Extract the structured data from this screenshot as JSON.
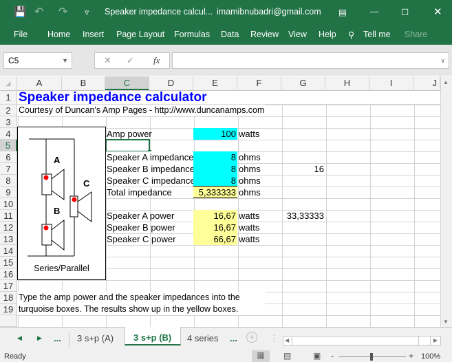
{
  "title_bar": {
    "doc_title": "Speaker impedance calcul...",
    "account": "imamibnubadri@gmail.com"
  },
  "ribbon": {
    "tabs": [
      "File",
      "Home",
      "Insert",
      "Page Layout",
      "Formulas",
      "Data",
      "Review",
      "View",
      "Help"
    ],
    "tell_me": "Tell me",
    "share": "Share"
  },
  "formula_bar": {
    "name_box": "C5",
    "fx": "fx",
    "value": ""
  },
  "columns": [
    "A",
    "B",
    "C",
    "D",
    "E",
    "F",
    "G",
    "H",
    "I",
    "J"
  ],
  "rows": [
    "1",
    "2",
    "3",
    "4",
    "5",
    "6",
    "7",
    "8",
    "9",
    "10",
    "11",
    "12",
    "13",
    "14",
    "15",
    "16",
    "17",
    "18",
    "19"
  ],
  "sheet": {
    "title": "Speaker impedance calculator",
    "courtesy": "Courtesy of Duncan's Amp Pages - http://www.duncanamps.com",
    "amp_label": "Amp power",
    "amp_value": "100",
    "amp_unit": "watts",
    "a_imp_label": "Speaker A impedance",
    "a_imp": "8",
    "a_imp_unit": "ohms",
    "b_imp_label": "Speaker B impedance",
    "b_imp": "8",
    "b_imp_unit": "ohms",
    "g7": "16",
    "c_imp_label": "Speaker C impedance",
    "c_imp": "8",
    "c_imp_unit": "ohms",
    "total_label": "Total impedance",
    "total": "5,333333",
    "total_unit": "ohms",
    "a_pow_label": "Speaker A power",
    "a_pow": "16,67",
    "a_pow_unit": "watts",
    "g11": "33,33333",
    "b_pow_label": "Speaker B power",
    "b_pow": "16,67",
    "b_pow_unit": "watts",
    "c_pow_label": "Speaker C power",
    "c_pow": "66,67",
    "c_pow_unit": "watts",
    "note1": "Type the amp power and the speaker impedances into the",
    "note2": "turquoise boxes.  The results show up in the yellow boxes.",
    "diagram": {
      "label_a": "A",
      "label_b": "B",
      "label_c": "C",
      "caption": "Series/Parallel"
    }
  },
  "sheet_tabs": {
    "more": "...",
    "tabs": [
      "3 s+p (A)",
      "3 s+p (B)",
      "4 series"
    ],
    "active": "3 s+p (B)"
  },
  "status": {
    "text": "Ready",
    "zoom": "100%"
  }
}
